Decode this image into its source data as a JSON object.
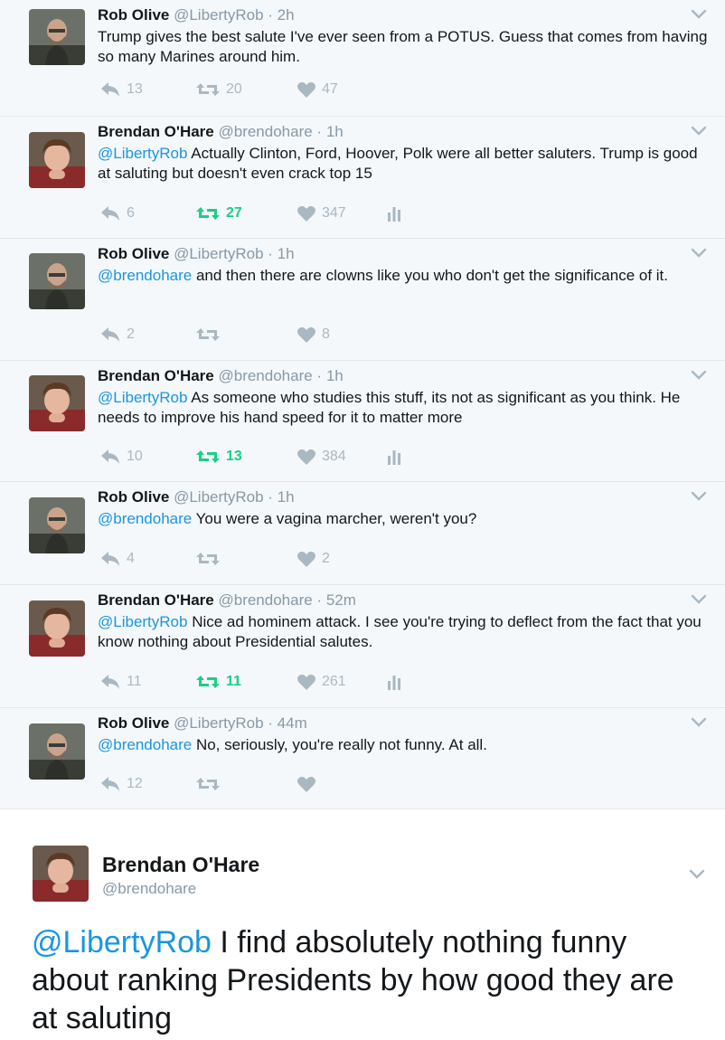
{
  "tweets": [
    {
      "name": "Rob Olive",
      "handle": "@LibertyRob",
      "time": "2h",
      "mention": "",
      "text": "Trump gives the best salute I've ever seen from a POTUS. Guess that comes from having so many Marines around him.",
      "replies": "13",
      "retweets": "20",
      "likes": "47",
      "rt_active": false,
      "analytics": false,
      "avatar": "rob"
    },
    {
      "name": "Brendan O'Hare",
      "handle": "@brendohare",
      "time": "1h",
      "mention": "@LibertyRob",
      "text": " Actually Clinton, Ford, Hoover, Polk were all better saluters. Trump is good at saluting but doesn't even crack top 15",
      "replies": "6",
      "retweets": "27",
      "likes": "347",
      "rt_active": true,
      "analytics": true,
      "avatar": "brendan"
    },
    {
      "name": "Rob Olive",
      "handle": "@LibertyRob",
      "time": "1h",
      "mention": "@brendohare",
      "text": " and then there are clowns like you who don't get the significance of it.",
      "replies": "2",
      "retweets": "",
      "likes": "8",
      "rt_active": false,
      "analytics": false,
      "avatar": "rob"
    },
    {
      "name": "Brendan O'Hare",
      "handle": "@brendohare",
      "time": "1h",
      "mention": "@LibertyRob",
      "text": " As someone who studies this stuff, its not as significant as you think. He needs to improve his hand speed for it to matter more",
      "replies": "10",
      "retweets": "13",
      "likes": "384",
      "rt_active": true,
      "analytics": true,
      "avatar": "brendan"
    },
    {
      "name": "Rob Olive",
      "handle": "@LibertyRob",
      "time": "1h",
      "mention": "@brendohare",
      "text": " You were a vagina marcher, weren't you?",
      "replies": "4",
      "retweets": "",
      "likes": "2",
      "rt_active": false,
      "analytics": false,
      "avatar": "rob"
    },
    {
      "name": "Brendan O'Hare",
      "handle": "@brendohare",
      "time": "52m",
      "mention": "@LibertyRob",
      "text": " Nice ad hominem attack. I see you're trying to deflect from the fact that you know nothing about Presidential salutes.",
      "replies": "11",
      "retweets": "11",
      "likes": "261",
      "rt_active": true,
      "analytics": true,
      "avatar": "brendan"
    },
    {
      "name": "Rob Olive",
      "handle": "@LibertyRob",
      "time": "44m",
      "mention": "@brendohare",
      "text": " No, seriously, you're really not funny. At all.",
      "replies": "12",
      "retweets": "",
      "likes": "",
      "rt_active": false,
      "analytics": false,
      "avatar": "rob"
    }
  ],
  "main_tweet": {
    "name": "Brendan O'Hare",
    "handle": "@brendohare",
    "mention": "@LibertyRob",
    "text": " I find absolutely nothing funny about ranking Presidents by how good they are at saluting"
  },
  "colors": {
    "background_thread": "#f5f8fa",
    "link": "#1b95e0",
    "muted": "#8899a6",
    "icon": "#aab8c2",
    "retweet_active": "#19cf86"
  },
  "icons": [
    "reply-icon",
    "retweet-icon",
    "like-icon",
    "analytics-icon",
    "chevron-down-icon"
  ]
}
